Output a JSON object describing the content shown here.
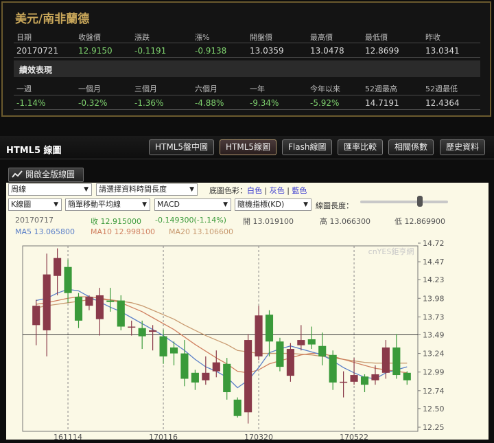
{
  "quote": {
    "title": "美元/南非蘭德",
    "headers": [
      "日期",
      "收盤價",
      "漲跌",
      "漲%",
      "開盤價",
      "最高價",
      "最低價",
      "昨收"
    ],
    "values": [
      "20170721",
      "12.9150",
      "-0.1191",
      "-0.9138",
      "13.0359",
      "13.0478",
      "12.8699",
      "13.0341"
    ],
    "perf_title": "績效表現",
    "perf_headers": [
      "一週",
      "一個月",
      "三個月",
      "六個月",
      "一年",
      "今年以來",
      "52週最高",
      "52週最低"
    ],
    "perf_values": [
      "-1.14%",
      "-0.32%",
      "-1.36%",
      "-4.88%",
      "-9.34%",
      "-5.92%",
      "14.7191",
      "12.4364"
    ]
  },
  "chart_header": {
    "title": "HTML5 線圖",
    "tabs": [
      "HTML5盤中圖",
      "HTML5線圖",
      "Flash線圖",
      "匯率比較",
      "相關係數",
      "歷史資料"
    ],
    "active_tab": 1
  },
  "toolbar": {
    "full_button": "開啟全版線圖",
    "period": "周線",
    "range": "請選擇資料時間長度",
    "bg_label": "底圖色彩：",
    "bg_white": "白色",
    "bg_gray": "灰色",
    "bg_blue": "藍色",
    "chart_type": "K線圖",
    "ma_type": "簡單移動平均線",
    "indicator1": "MACD",
    "indicator2": "隨機指標(KD)",
    "line_len_label": "線圖長度："
  },
  "readout": {
    "date": "20170717",
    "close": "收 12.915000",
    "change": "-0.149300(-1.14%)",
    "open": "開 13.019100",
    "high": "高 13.066300",
    "low": "低 12.869900",
    "ma5": "MA5 13.065800",
    "ma10": "MA10 12.998100",
    "ma20": "MA20 13.106600"
  },
  "watermark": "cnYES鉅亨網",
  "colors": {
    "up": "#8a3a4a",
    "down": "#3a9a3a",
    "ma5": "#5a7fc8",
    "ma10": "#d08060",
    "ma20": "#c89a70",
    "gold": "#c9a75a"
  },
  "chart_data": {
    "type": "candlestick",
    "y_ticks": [
      "14.72",
      "14.47",
      "14.23",
      "13.98",
      "13.73",
      "13.49",
      "13.24",
      "12.99",
      "12.74",
      "12.50",
      "12.25"
    ],
    "ylim": [
      12.25,
      14.72
    ],
    "x_ticks": [
      "161114",
      "170116",
      "170320",
      "170522"
    ],
    "candles": [
      {
        "o": 13.62,
        "c": 13.88,
        "h": 13.96,
        "l": 13.35
      },
      {
        "o": 13.55,
        "c": 14.3,
        "h": 14.58,
        "l": 13.2
      },
      {
        "o": 14.28,
        "c": 14.52,
        "h": 14.65,
        "l": 14.02
      },
      {
        "o": 14.4,
        "c": 14.05,
        "h": 14.5,
        "l": 13.92
      },
      {
        "o": 14.0,
        "c": 13.68,
        "h": 14.05,
        "l": 13.58
      },
      {
        "o": 13.88,
        "c": 14.0,
        "h": 14.02,
        "l": 13.82
      },
      {
        "o": 13.7,
        "c": 14.02,
        "h": 14.12,
        "l": 13.48
      },
      {
        "o": 13.95,
        "c": 13.93,
        "h": 14.12,
        "l": 13.8
      },
      {
        "o": 13.95,
        "c": 13.6,
        "h": 14.02,
        "l": 13.55
      },
      {
        "o": 13.6,
        "c": 13.6,
        "h": 13.68,
        "l": 13.48
      },
      {
        "o": 13.58,
        "c": 13.47,
        "h": 13.68,
        "l": 13.3
      },
      {
        "o": 13.53,
        "c": 13.55,
        "h": 13.62,
        "l": 13.28
      },
      {
        "o": 13.47,
        "c": 13.2,
        "h": 13.56,
        "l": 13.1
      },
      {
        "o": 13.32,
        "c": 13.24,
        "h": 13.4,
        "l": 13.08
      },
      {
        "o": 13.24,
        "c": 12.9,
        "h": 13.42,
        "l": 12.8
      },
      {
        "o": 12.98,
        "c": 12.85,
        "h": 13.02,
        "l": 12.75
      },
      {
        "o": 12.88,
        "c": 12.98,
        "h": 13.2,
        "l": 12.82
      },
      {
        "o": 13.0,
        "c": 13.12,
        "h": 13.28,
        "l": 12.92
      },
      {
        "o": 13.1,
        "c": 12.72,
        "h": 13.18,
        "l": 12.62
      },
      {
        "o": 12.62,
        "c": 12.4,
        "h": 12.65,
        "l": 12.38
      },
      {
        "o": 12.45,
        "c": 13.42,
        "h": 13.5,
        "l": 12.3
      },
      {
        "o": 13.2,
        "c": 13.75,
        "h": 13.88,
        "l": 13.15
      },
      {
        "o": 13.76,
        "c": 13.4,
        "h": 13.82,
        "l": 13.2
      },
      {
        "o": 13.4,
        "c": 13.06,
        "h": 13.45,
        "l": 13.0
      },
      {
        "o": 12.94,
        "c": 13.3,
        "h": 13.38,
        "l": 12.86
      },
      {
        "o": 13.35,
        "c": 13.42,
        "h": 13.62,
        "l": 13.28
      },
      {
        "o": 13.43,
        "c": 13.36,
        "h": 13.6,
        "l": 13.3
      },
      {
        "o": 13.34,
        "c": 13.2,
        "h": 13.52,
        "l": 13.08
      },
      {
        "o": 13.22,
        "c": 12.85,
        "h": 13.28,
        "l": 12.75
      },
      {
        "o": 12.85,
        "c": 12.86,
        "h": 13.0,
        "l": 12.65
      },
      {
        "o": 12.86,
        "c": 12.95,
        "h": 13.18,
        "l": 12.82
      },
      {
        "o": 12.93,
        "c": 12.82,
        "h": 12.96,
        "l": 12.72
      },
      {
        "o": 12.88,
        "c": 12.96,
        "h": 13.08,
        "l": 12.82
      },
      {
        "o": 12.98,
        "c": 13.32,
        "h": 13.42,
        "l": 12.9
      },
      {
        "o": 13.32,
        "c": 12.95,
        "h": 13.5,
        "l": 12.9
      },
      {
        "o": 12.98,
        "c": 12.88,
        "h": 13.0,
        "l": 12.82
      }
    ],
    "ma5": [
      13.95,
      13.98,
      14.05,
      14.1,
      14.08,
      14.0,
      13.93,
      13.86,
      13.8,
      13.72,
      13.64,
      13.56,
      13.48,
      13.38,
      13.28,
      13.16,
      13.06,
      13.0,
      12.92,
      12.78,
      12.88,
      13.05,
      13.25,
      13.3,
      13.34,
      13.3,
      13.26,
      13.22,
      13.14,
      13.05,
      12.98,
      12.92,
      12.9,
      12.98,
      13.02,
      13.06
    ],
    "ma10": [
      13.9,
      13.92,
      13.95,
      13.98,
      14.0,
      14.0,
      13.98,
      13.96,
      13.92,
      13.86,
      13.8,
      13.72,
      13.64,
      13.56,
      13.46,
      13.36,
      13.27,
      13.18,
      13.1,
      13.0,
      12.98,
      13.02,
      13.1,
      13.14,
      13.18,
      13.22,
      13.24,
      13.24,
      13.2,
      13.16,
      13.12,
      13.08,
      13.04,
      13.02,
      13.0,
      12.98
    ],
    "ma20": [
      13.85,
      13.88,
      13.9,
      13.92,
      13.94,
      13.96,
      13.96,
      13.96,
      13.94,
      13.92,
      13.88,
      13.82,
      13.76,
      13.7,
      13.62,
      13.55,
      13.48,
      13.42,
      13.36,
      13.28,
      13.26,
      13.24,
      13.24,
      13.24,
      13.24,
      13.23,
      13.22,
      13.2,
      13.18,
      13.16,
      13.14,
      13.12,
      13.11,
      13.11,
      13.11,
      13.11
    ],
    "xlabel": "",
    "ylabel": ""
  }
}
